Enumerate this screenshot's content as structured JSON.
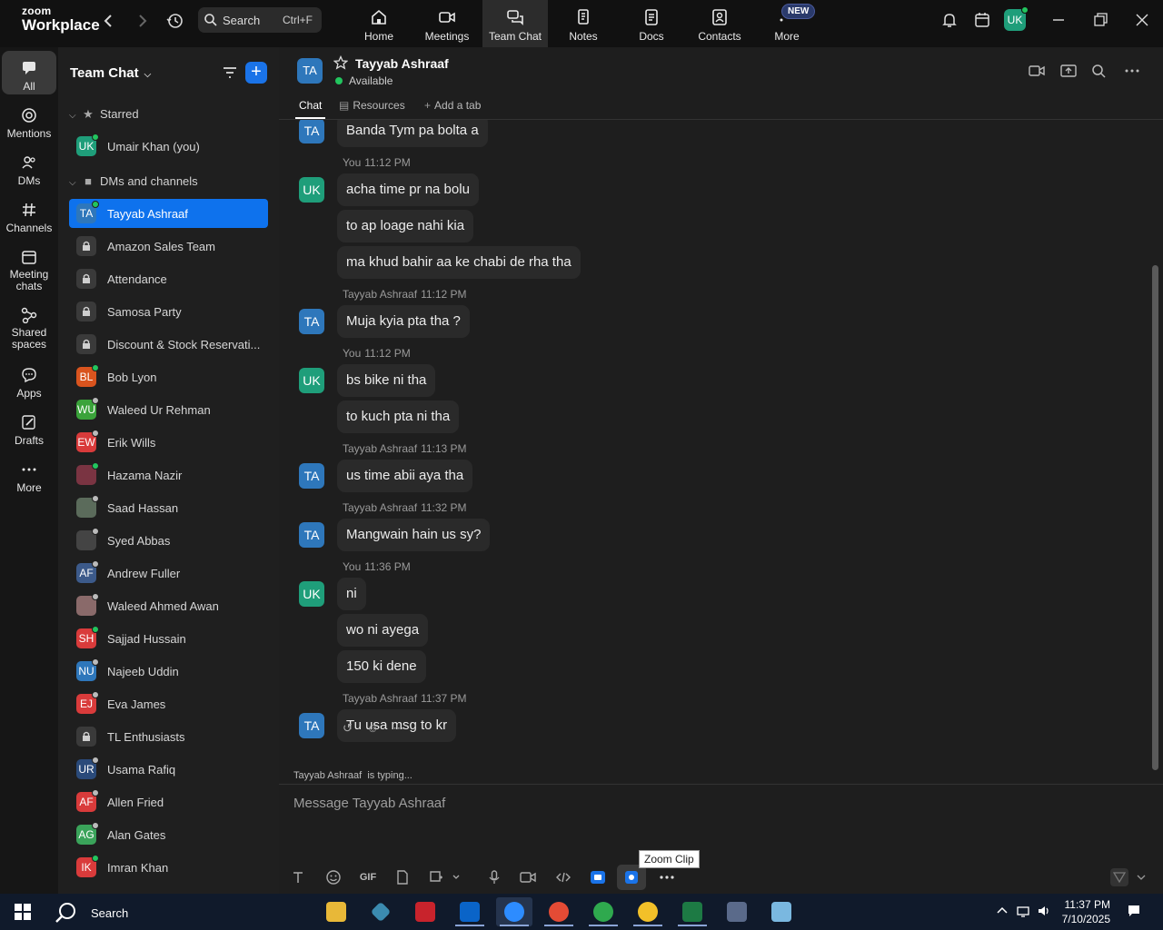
{
  "topbar": {
    "logo_small": "zoom",
    "logo_big": "Workplace",
    "search_label": "Search",
    "search_shortcut": "Ctrl+F",
    "tabs": [
      {
        "label": "Home",
        "icon": "home-icon"
      },
      {
        "label": "Meetings",
        "icon": "video-camera-icon"
      },
      {
        "label": "Team Chat",
        "icon": "chat-bubbles-icon"
      },
      {
        "label": "Notes",
        "icon": "notes-icon"
      },
      {
        "label": "Docs",
        "icon": "docs-icon"
      },
      {
        "label": "Contacts",
        "icon": "contacts-icon"
      },
      {
        "label": "More",
        "icon": "more-dots-icon"
      }
    ],
    "new_badge": "NEW",
    "user_initials": "UK"
  },
  "rail": {
    "items": [
      {
        "label": "All",
        "icon": "chat-icon"
      },
      {
        "label": "Mentions",
        "icon": "at-sign-icon"
      },
      {
        "label": "DMs",
        "icon": "people-icon"
      },
      {
        "label": "Channels",
        "icon": "hash-icon"
      },
      {
        "label": "Meeting chats",
        "icon": "calendar-icon"
      },
      {
        "label": "Shared spaces",
        "icon": "shared-nodes-icon"
      },
      {
        "label": "Apps",
        "icon": "apps-bubble-icon"
      },
      {
        "label": "Drafts",
        "icon": "draft-pencil-icon"
      },
      {
        "label": "More",
        "icon": "ellipsis-icon"
      }
    ]
  },
  "sidebar": {
    "title": "Team Chat",
    "section_starred": "Starred",
    "section_dms": "DMs and channels",
    "starred": [
      {
        "initials": "UK",
        "name": "Umair Khan (you)",
        "color": "#1f9e7a",
        "status": "#22c55e"
      }
    ],
    "items": [
      {
        "initials": "TA",
        "name": "Tayyab Ashraaf",
        "color": "#2e77bb",
        "status": "#22c55e",
        "active": true
      },
      {
        "initials": "",
        "name": "Amazon Sales Team",
        "lock": true
      },
      {
        "initials": "",
        "name": "Attendance",
        "lock": true
      },
      {
        "initials": "",
        "name": "Samosa Party",
        "lock": true
      },
      {
        "initials": "",
        "name": "Discount & Stock Reservati...",
        "lock": true
      },
      {
        "initials": "BL",
        "name": "Bob Lyon",
        "color": "#d9541e",
        "status": "#22c55e"
      },
      {
        "initials": "WU",
        "name": "Waleed Ur Rehman",
        "color": "#3aa33a",
        "status": "#bbbbbb"
      },
      {
        "initials": "EW",
        "name": "Erik Wills",
        "color": "#d93b3b",
        "status": "#bbbbbb"
      },
      {
        "initials": "",
        "name": "Hazama Nazir",
        "color": "#7a3442",
        "status": "#22c55e"
      },
      {
        "initials": "",
        "name": "Saad Hassan",
        "color": "#5b6b5b",
        "status": "#bbbbbb"
      },
      {
        "initials": "",
        "name": "Syed Abbas",
        "color": "#444444",
        "status": "#bbbbbb"
      },
      {
        "initials": "AF",
        "name": "Andrew Fuller",
        "color": "#3c5a8a",
        "status": "#bbbbbb"
      },
      {
        "initials": "",
        "name": "Waleed Ahmed Awan",
        "color": "#8a6a6a",
        "status": "#bbbbbb"
      },
      {
        "initials": "SH",
        "name": "Sajjad Hussain",
        "color": "#d93b3b",
        "status": "#22c55e"
      },
      {
        "initials": "NU",
        "name": "Najeeb Uddin",
        "color": "#2e77bb",
        "status": "#bbbbbb"
      },
      {
        "initials": "EJ",
        "name": "Eva James",
        "color": "#d93b3b",
        "status": "#bbbbbb"
      },
      {
        "initials": "",
        "name": "TL Enthusiasts",
        "lock": true
      },
      {
        "initials": "UR",
        "name": "Usama Rafiq",
        "color": "#2a4a7a",
        "status": "#bbbbbb"
      },
      {
        "initials": "AF",
        "name": "Allen Fried",
        "color": "#d93b3b",
        "status": "#bbbbbb"
      },
      {
        "initials": "AG",
        "name": "Alan Gates",
        "color": "#3aa35a",
        "status": "#bbbbbb"
      },
      {
        "initials": "IK",
        "name": "Imran Khan",
        "color": "#d93b3b",
        "status": "#22c55e"
      }
    ]
  },
  "chat": {
    "initials": "TA",
    "name": "Tayyab Ashraaf",
    "status": "Available",
    "tabs": [
      "Chat",
      "Resources",
      "Add a tab"
    ],
    "messages": [
      {
        "type": "bubble",
        "text": "Banda Tym pa bolta a",
        "avatar": "TA"
      },
      {
        "type": "meta",
        "who": "You",
        "time": "11:12 PM"
      },
      {
        "type": "bubble",
        "text": "acha time pr na bolu",
        "avatar": "UK"
      },
      {
        "type": "bubble",
        "text": "to ap loage nahi kia"
      },
      {
        "type": "bubble",
        "text": "ma khud bahir aa ke chabi de rha tha"
      },
      {
        "type": "meta",
        "who": "Tayyab Ashraaf",
        "time": "11:12 PM"
      },
      {
        "type": "bubble",
        "text": "Muja kyia pta tha ?",
        "avatar": "TA"
      },
      {
        "type": "meta",
        "who": "You",
        "time": "11:12 PM"
      },
      {
        "type": "bubble",
        "text": "bs bike ni tha",
        "avatar": "UK"
      },
      {
        "type": "bubble",
        "text": "to kuch pta ni tha"
      },
      {
        "type": "meta",
        "who": "Tayyab Ashraaf",
        "time": "11:13 PM"
      },
      {
        "type": "bubble",
        "text": "us time abii aya tha",
        "avatar": "TA"
      },
      {
        "type": "meta",
        "who": "Tayyab Ashraaf",
        "time": "11:32 PM"
      },
      {
        "type": "bubble",
        "text": "Mangwain hain us sy?",
        "avatar": "TA"
      },
      {
        "type": "meta",
        "who": "You",
        "time": "11:36 PM"
      },
      {
        "type": "bubble",
        "text": "ni",
        "avatar": "UK"
      },
      {
        "type": "bubble",
        "text": "wo ni ayega"
      },
      {
        "type": "bubble",
        "text": "150 ki dene"
      },
      {
        "type": "meta",
        "who": "Tayyab Ashraaf",
        "time": "11:37 PM"
      },
      {
        "type": "bubble",
        "text": "Tu usa msg to kr",
        "avatar": "TA"
      }
    ],
    "typing_name": "Tayyab Ashraaf",
    "typing_suffix": "is typing...",
    "composer_placeholder": "Message Tayyab Ashraaf",
    "gif_label": "GIF",
    "tooltip": "Zoom Clip"
  },
  "taskbar": {
    "search_label": "Search",
    "time": "11:37 PM",
    "date": "7/10/2025"
  }
}
